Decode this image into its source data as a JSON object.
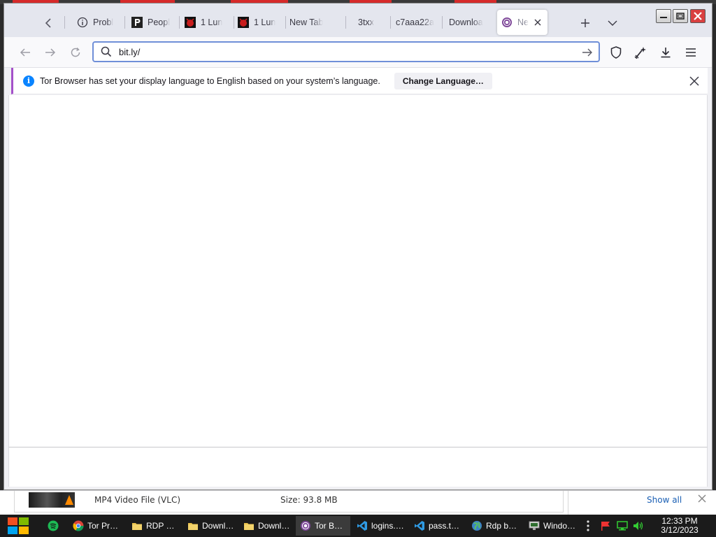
{
  "browser": {
    "tabs": [
      {
        "label": "Probl",
        "icon": "info-icon"
      },
      {
        "label": "Peopl",
        "icon": "p-logo-icon"
      },
      {
        "label": "1 Lun",
        "icon": "red-devil-icon"
      },
      {
        "label": "1 Lun",
        "icon": "red-devil-icon"
      },
      {
        "label": "New Tab",
        "icon": ""
      },
      {
        "label": "3txx",
        "icon": ""
      },
      {
        "label": "c7aaa22a",
        "icon": ""
      },
      {
        "label": "Downloa",
        "icon": ""
      },
      {
        "label": "Ne",
        "icon": "tor-onion-icon",
        "active": true
      }
    ],
    "url_value": "bit.ly/",
    "notification": {
      "text": "Tor Browser has set your display language to English based on your system’s language.",
      "button": "Change Language…"
    },
    "colors": {
      "accent": "#a451c9",
      "info": "#0a84ff",
      "url_focus": "#6f8fd8"
    }
  },
  "download_bar": {
    "file_type": "MP4 Video File (VLC)",
    "size": "Size: 93.8 MB",
    "show_all": "Show all"
  },
  "taskbar": {
    "items": [
      {
        "label": "Tor Pr…",
        "icon": "chrome-icon"
      },
      {
        "label": "RDP …",
        "icon": "folder-icon"
      },
      {
        "label": "Downl…",
        "icon": "folder-icon"
      },
      {
        "label": "Downl…",
        "icon": "folder-icon"
      },
      {
        "label": "Tor B…",
        "icon": "tor-onion-icon",
        "active": true
      },
      {
        "label": "logins.…",
        "icon": "vscode-icon"
      },
      {
        "label": "pass.t…",
        "icon": "vscode-icon"
      },
      {
        "label": "Rdp b…",
        "icon": "globe-icon"
      },
      {
        "label": "Windo…",
        "icon": "monitor-icon"
      }
    ],
    "time": "12:33 PM",
    "date": "3/12/2023"
  }
}
